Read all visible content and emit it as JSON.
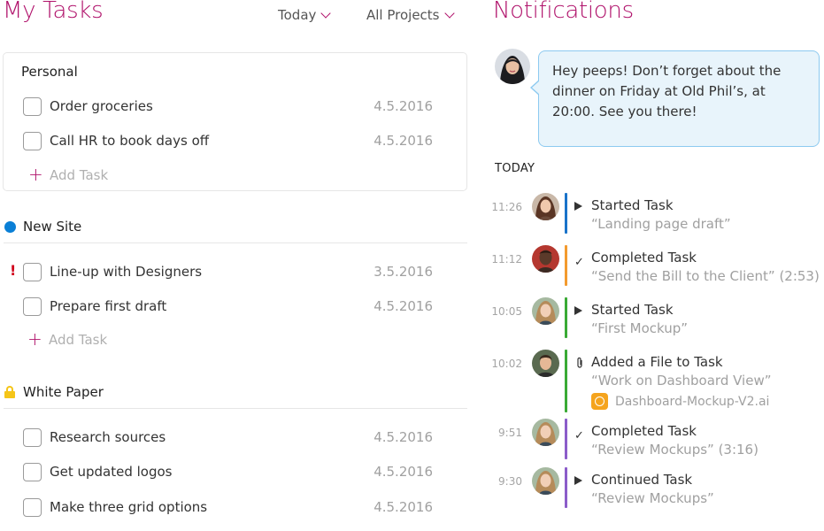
{
  "tasks": {
    "title": "My Tasks",
    "filters": {
      "date": "Today",
      "project": "All Projects"
    },
    "add_label": "Add Task",
    "groups": [
      {
        "name": "Personal",
        "tasks": [
          {
            "name": "Order groceries",
            "date": "4.5.2016"
          },
          {
            "name": "Call HR to book days off",
            "date": "4.5.2016"
          }
        ]
      },
      {
        "name": "New Site",
        "marker_color": "#0a7fd6",
        "tasks": [
          {
            "name": "Line-up with Designers",
            "date": "3.5.2016",
            "priority": "!"
          },
          {
            "name": "Prepare first draft",
            "date": "4.5.2016"
          }
        ]
      },
      {
        "name": "White Paper",
        "marker_color": "#f5c518",
        "marker_icon": "lock-icon",
        "tasks": [
          {
            "name": "Research sources",
            "date": "4.5.2016"
          },
          {
            "name": "Get updated logos",
            "date": "4.5.2016"
          },
          {
            "name": "Make three grid options",
            "date": "4.5.2016"
          }
        ]
      }
    ]
  },
  "notifications": {
    "title": "Notifications",
    "message": "Hey peeps! Don’t forget about the dinner on Friday at Old Phil’s, at 20:00. See you there!",
    "today_label": "TODAY",
    "activity": [
      {
        "time": "11:26",
        "icon": "play-icon",
        "action": "Started Task",
        "detail": "“Landing page draft”",
        "color": "#1a73c9"
      },
      {
        "time": "11:12",
        "icon": "check-icon",
        "action": "Completed Task",
        "detail": "“Send the Bill to the Client” (2:53)",
        "color": "#f39a2e"
      },
      {
        "time": "10:05",
        "icon": "play-icon",
        "action": "Started Task",
        "detail": "“First Mockup”",
        "color": "#3aaa35"
      },
      {
        "time": "10:02",
        "icon": "paperclip-icon",
        "action": "Added a File to Task",
        "detail": "“Work on Dashboard View”",
        "file": "Dashboard-Mockup-V2.ai",
        "color": "#3aaa35"
      },
      {
        "time": "9:51",
        "icon": "check-icon",
        "action": "Completed Task",
        "detail": "“Review Mockups” (3:16)",
        "color": "#8b5cc9"
      },
      {
        "time": "9:30",
        "icon": "play-icon",
        "action": "Continued Task",
        "detail": "“Review Mockups”",
        "color": "#8b5cc9"
      }
    ]
  },
  "colors": {
    "accent": "#b0126b",
    "bubble_bg": "#e8f4fb",
    "bubble_border": "#8dcaf0",
    "file_icon": "#f5a41d"
  }
}
